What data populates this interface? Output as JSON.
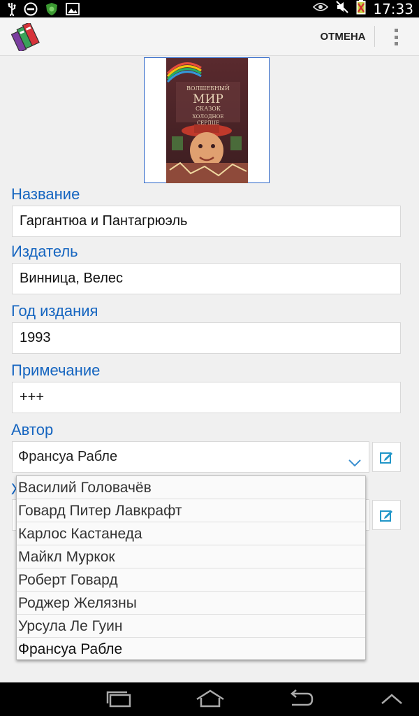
{
  "status_bar": {
    "time": "17:33",
    "left_icons": [
      "usb-icon",
      "do-not-disturb-icon",
      "shield-app-icon",
      "image-icon"
    ],
    "right_icons": [
      "eye-icon",
      "mute-icon",
      "battery-charging-icon"
    ]
  },
  "action_bar": {
    "cancel_label": "ОТМЕНА",
    "app_icon": "books-icon",
    "overflow_icon": "overflow-menu-icon"
  },
  "cover": {
    "line1": "ВОЛШЕБНЫЙ",
    "line2": "МИР",
    "line3": "СКАЗОК",
    "line4": "ХОЛОДНОЕ",
    "line5": "СЕРДЦЕ"
  },
  "form": {
    "title_label": "Название",
    "title_value": "Гаргантюа и Пантагрюэль",
    "publisher_label": "Издатель",
    "publisher_value": "Винница, Велес",
    "year_label": "Год  издания",
    "year_value": "1993",
    "note_label": "Примечание",
    "note_value": "+++",
    "author_label": "Автор",
    "author_value": "Франсуа Рабле",
    "genre_label_partial": "Ж"
  },
  "author_dropdown": {
    "items": [
      "Василий Головачёв",
      "Говард Питер Лавкрафт",
      "Карлос Кастанеда",
      "Майкл Муркок",
      "Роберт Говард",
      "Роджер Желязны",
      "Урсула Ле Гуин",
      "Франсуа Рабле"
    ],
    "selected": "Франсуа Рабле"
  },
  "nav_bar": {
    "buttons": [
      "recent-apps-icon",
      "home-icon",
      "back-icon",
      "hide-keyboard-icon"
    ]
  },
  "colors": {
    "accent": "#1565c0",
    "edit_icon": "#2196c8",
    "chevron": "#3a8fd0"
  }
}
